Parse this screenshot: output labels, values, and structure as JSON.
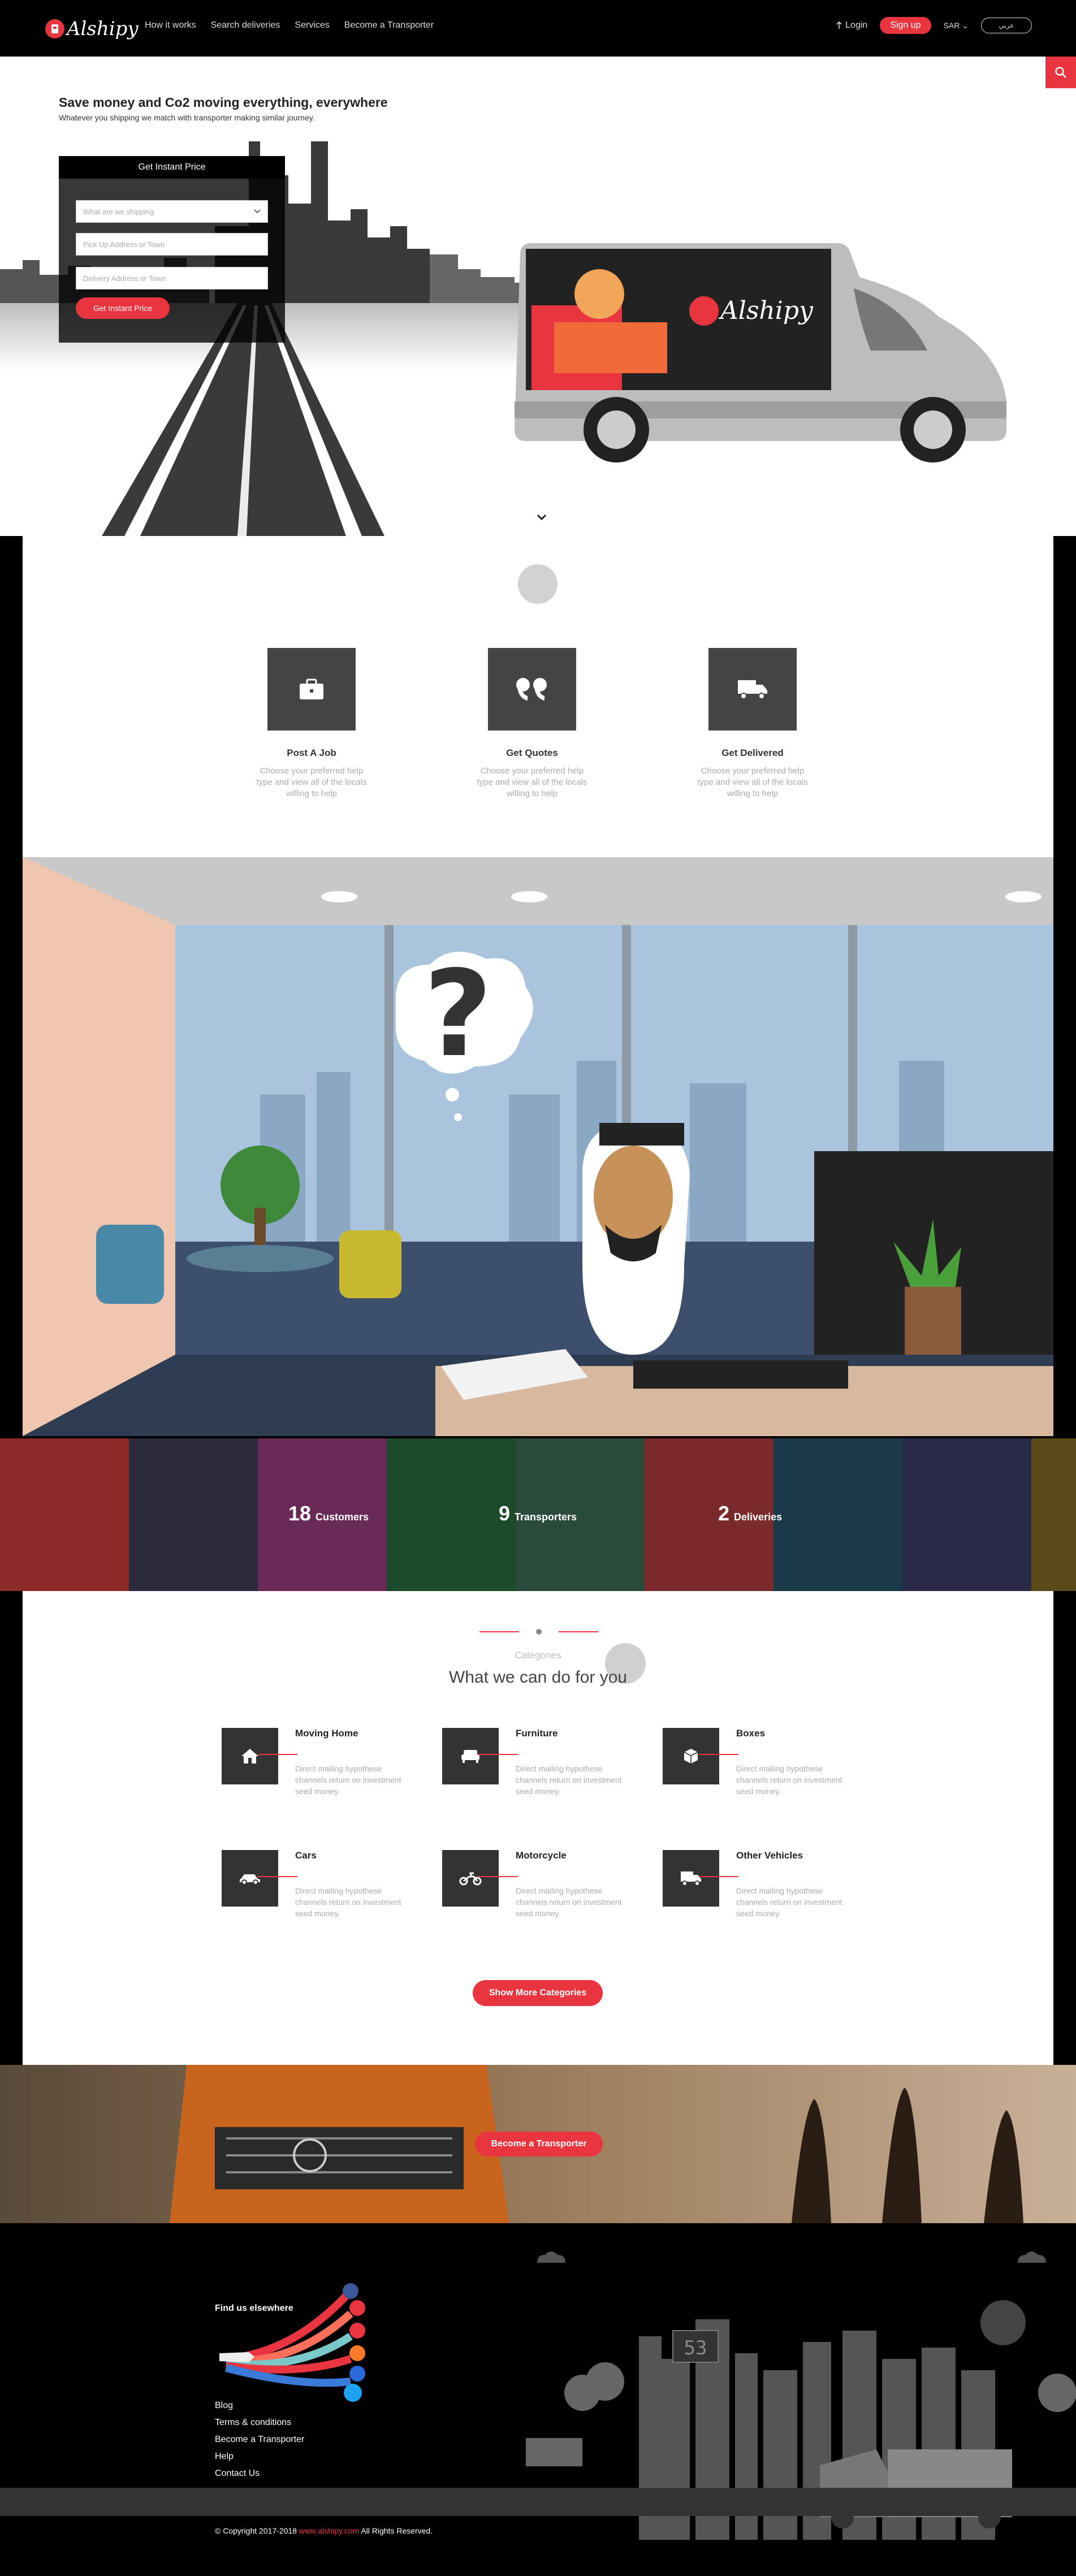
{
  "brand": {
    "name": "Alshipy",
    "accent": "#e8353f"
  },
  "nav": {
    "links": [
      "How it works",
      "Search deliveries",
      "Services",
      "Become a Transporter"
    ],
    "login": "Login",
    "signup": "Sign up",
    "currency": "SAR",
    "language": "عربي"
  },
  "hero": {
    "title": "Save money and Co2 moving everything, everywhere",
    "subtitle": "Whatever you shipping we match with transporter making similar journey.",
    "quote_box": {
      "header": "Get Instant Price",
      "select_placeholder": "What are we shipping",
      "pickup_placeholder": "Pick Up Address or Town",
      "delivery_placeholder": "Delivery Address or Town",
      "button": "Get Instant Price"
    }
  },
  "how_it_works": {
    "steps": [
      {
        "icon": "briefcase-icon",
        "title": "Post A Job",
        "desc": "Choose your preferred help type and view all of the locals willing to help"
      },
      {
        "icon": "quote-icon",
        "title": "Get Quotes",
        "desc": "Choose your preferred help type and view all of the locals willing to help"
      },
      {
        "icon": "truck-icon",
        "title": "Get Delivered",
        "desc": "Choose your preferred help type and view all of the locals willing to help"
      }
    ]
  },
  "stats": [
    {
      "number": "18",
      "label": "Customers"
    },
    {
      "number": "9",
      "label": "Transporters"
    },
    {
      "number": "2",
      "label": "Deliveries"
    }
  ],
  "categories": {
    "kicker": "Categories",
    "title": "What we can do for you",
    "items": [
      {
        "icon": "home-icon",
        "title": "Moving Home",
        "desc": "Direct mailing hypothese channels return on investment seed money."
      },
      {
        "icon": "sofa-icon",
        "title": "Furniture",
        "desc": "Direct mailing hypothese channels return on investment seed money."
      },
      {
        "icon": "box-icon",
        "title": "Boxes",
        "desc": "Direct mailing hypothese channels return on investment seed money."
      },
      {
        "icon": "car-icon",
        "title": "Cars",
        "desc": "Direct mailing hypothese channels return on investment seed money."
      },
      {
        "icon": "motorcycle-icon",
        "title": "Motorcycle",
        "desc": "Direct mailing hypothese channels return on investment seed money."
      },
      {
        "icon": "truck-icon",
        "title": "Other Vehicles",
        "desc": "Direct mailing hypothese channels return on investment seed money."
      }
    ],
    "more_button": "Show More Categories"
  },
  "banner": {
    "button": "Become a Transporter"
  },
  "footer": {
    "find_us": "Find us elsewhere",
    "links": [
      "Blog",
      "Terms & conditions",
      "Become a Transporter",
      "Help",
      "Contact Us"
    ],
    "copyright_prefix": "© Copyright 2017-2018",
    "copyright_link": "www.alshipy.com",
    "copyright_suffix": "All Rights Reserved.",
    "speed_sign": "53"
  }
}
